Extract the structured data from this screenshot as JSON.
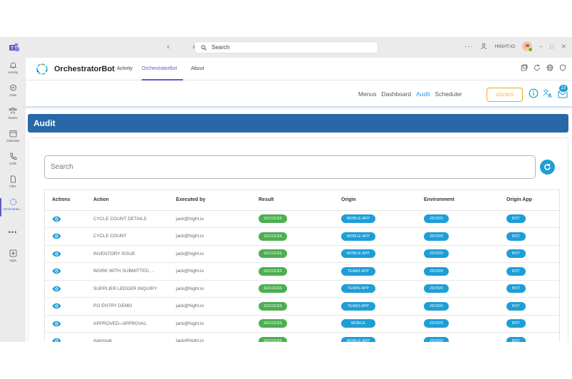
{
  "titlebar": {
    "search_placeholder": "Search",
    "org_name": "HIGHT.IO",
    "avatar_initials": "JB"
  },
  "rail": {
    "items": [
      {
        "label": "Activity",
        "icon": "bell-icon"
      },
      {
        "label": "Chat",
        "icon": "chat-icon"
      },
      {
        "label": "Teams",
        "icon": "teams-icon"
      },
      {
        "label": "Calendar",
        "icon": "calendar-icon"
      },
      {
        "label": "Calls",
        "icon": "phone-icon"
      },
      {
        "label": "Files",
        "icon": "file-icon"
      },
      {
        "label": "Orchestrato...",
        "icon": "orchestrator-icon"
      },
      {
        "label": "•••",
        "icon": "more-icon"
      },
      {
        "label": "Apps",
        "icon": "add-app-icon"
      }
    ]
  },
  "app_header": {
    "name": "OrchestratorBot",
    "tabs": [
      "Activity",
      "OrchestratorBot",
      "About"
    ],
    "active_tab": "OrchestratorBot"
  },
  "topnav": {
    "links": [
      "Menus",
      "Dashboard",
      "Audit",
      "Scheduler"
    ],
    "active": "Audit",
    "environment": "JDV920",
    "notification_count": "23"
  },
  "page": {
    "title": "Audit",
    "search_placeholder": "Search"
  },
  "table": {
    "headers": [
      "Actions",
      "Action",
      "Executed by",
      "Result",
      "Origin",
      "Environment",
      "Origin App"
    ],
    "rows": [
      {
        "action": "CYCLE COUNT DETAILS",
        "executed_by": "jack@hight.io",
        "result": "SUCCESS",
        "origin": "MOBILE APP",
        "environment": "JDV920",
        "origin_app": "BOT"
      },
      {
        "action": "CYCLE COUNT",
        "executed_by": "jack@hight.io",
        "result": "SUCCESS",
        "origin": "MOBILE APP",
        "environment": "JDV920",
        "origin_app": "BOT"
      },
      {
        "action": "INVENTORY ISSUE",
        "executed_by": "jack@hight.io",
        "result": "SUCCESS",
        "origin": "MOBILE APP",
        "environment": "JDV920",
        "origin_app": "BOT"
      },
      {
        "action": "WORK WITH SUBMITTED ...",
        "executed_by": "jack@hight.io",
        "result": "SUCCESS",
        "origin": "TEAMS APP",
        "environment": "JDV920",
        "origin_app": "BOT"
      },
      {
        "action": "SUPPLIER LEDGER INQUIRY",
        "executed_by": "jack@hight.io",
        "result": "SUCCESS",
        "origin": "TEAMS APP",
        "environment": "JDV920",
        "origin_app": "BOT"
      },
      {
        "action": "PO ENTRY DEMO",
        "executed_by": "jack@hight.io",
        "result": "SUCCESS",
        "origin": "TEAMS APP",
        "environment": "JDV920",
        "origin_app": "BOT"
      },
      {
        "action": "APPROVED--APPROVAL",
        "executed_by": "jack@hight.io",
        "result": "SUCCESS",
        "origin": "MOBILE",
        "environment": "JDV920",
        "origin_app": "BOT"
      },
      {
        "action": "Approval",
        "executed_by": "jack@hight.io",
        "result": "SUCCESS",
        "origin": "MOBILE APP",
        "environment": "JDV920",
        "origin_app": "BOT"
      }
    ]
  },
  "colors": {
    "banner": "#2868a8",
    "accent": "#1e9ed6",
    "success": "#4caf50",
    "teams_purple": "#5b5fc7",
    "env_orange": "#f5a623"
  }
}
